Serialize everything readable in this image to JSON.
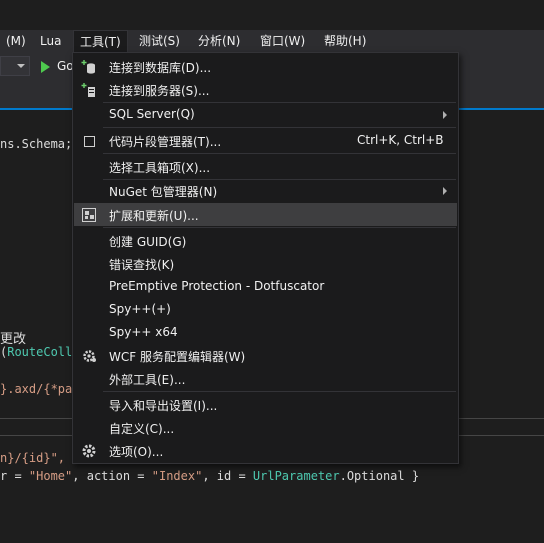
{
  "menubar": {
    "items": [
      "(M)",
      "Lua",
      "工具(T)",
      "测试(S)",
      "分析(N)",
      "窗口(W)",
      "帮助(H)"
    ]
  },
  "toolbar": {
    "go_label": "Go"
  },
  "code": {
    "line1": "ns.Schema;",
    "line2a": "更改",
    "line2b_plain": "(",
    "line2b_type": "RouteColle",
    "line3": "}.axd/{*pat",
    "line4": "n}/{id}\",",
    "line5_a": "r = ",
    "line5_s1": "\"Home\"",
    "line5_b": ", action = ",
    "line5_s2": "\"Index\"",
    "line5_c": ", id = ",
    "line5_t": "UrlParameter",
    "line5_d": ".Optional }"
  },
  "tools_menu": {
    "items": [
      {
        "label": "连接到数据库(D)...",
        "icon": "database-connect-icon"
      },
      {
        "label": "连接到服务器(S)...",
        "icon": "server-connect-icon"
      },
      {
        "label": "SQL Server(Q)",
        "submenu": true
      },
      {
        "label": "代码片段管理器(T)...",
        "shortcut": "Ctrl+K, Ctrl+B",
        "icon": "checkbox-icon"
      },
      {
        "label": "选择工具箱项(X)..."
      },
      {
        "label": "NuGet 包管理器(N)",
        "submenu": true
      },
      {
        "label": "扩展和更新(U)...",
        "icon": "extensions-icon"
      },
      {
        "label": "创建 GUID(G)"
      },
      {
        "label": "错误查找(K)"
      },
      {
        "label": "PreEmptive Protection - Dotfuscator"
      },
      {
        "label": "Spy++(+)"
      },
      {
        "label": "Spy++ x64"
      },
      {
        "label": "WCF 服务配置编辑器(W)",
        "icon": "wcf-gear-icon"
      },
      {
        "label": "外部工具(E)..."
      },
      {
        "label": "导入和导出设置(I)..."
      },
      {
        "label": "自定义(C)..."
      },
      {
        "label": "选项(O)...",
        "icon": "gear-icon"
      }
    ]
  },
  "colors": {
    "accent": "#007acc",
    "menu_bg": "#1b1b1c",
    "hover_bg": "#3e3e40",
    "string": "#d69d85",
    "type": "#4ec9b0"
  }
}
